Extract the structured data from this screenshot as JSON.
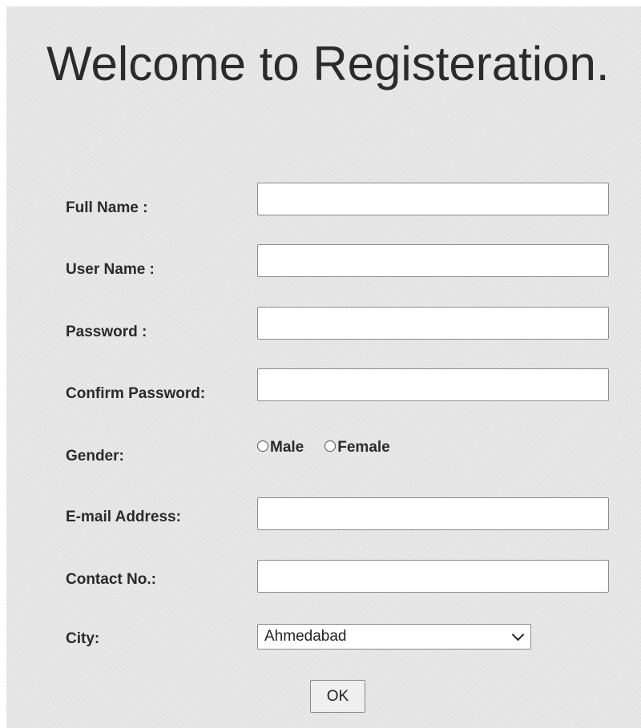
{
  "title": "Welcome to Registeration.",
  "form": {
    "full_name": {
      "label": "Full Name :",
      "value": ""
    },
    "user_name": {
      "label": "User Name :",
      "value": ""
    },
    "password": {
      "label": "Password :",
      "value": ""
    },
    "confirm_password": {
      "label": "Confirm Password:",
      "value": ""
    },
    "gender": {
      "label": "Gender:",
      "options": [
        "Male",
        "Female"
      ],
      "selected": null
    },
    "email": {
      "label": "E-mail Address:",
      "value": ""
    },
    "contact": {
      "label": "Contact No.:",
      "value": ""
    },
    "city": {
      "label": "City:",
      "selected": "Ahmedabad"
    },
    "submit_label": "OK"
  },
  "icons": {
    "city_dropdown": "chevron-down-icon",
    "radio": "radio-unchecked-icon"
  },
  "colors": {
    "background": "#e6e6e6",
    "text": "#2a2a2a",
    "input_border": "#8a8a8a",
    "input_background": "#ffffff",
    "button_background": "#efefef"
  }
}
